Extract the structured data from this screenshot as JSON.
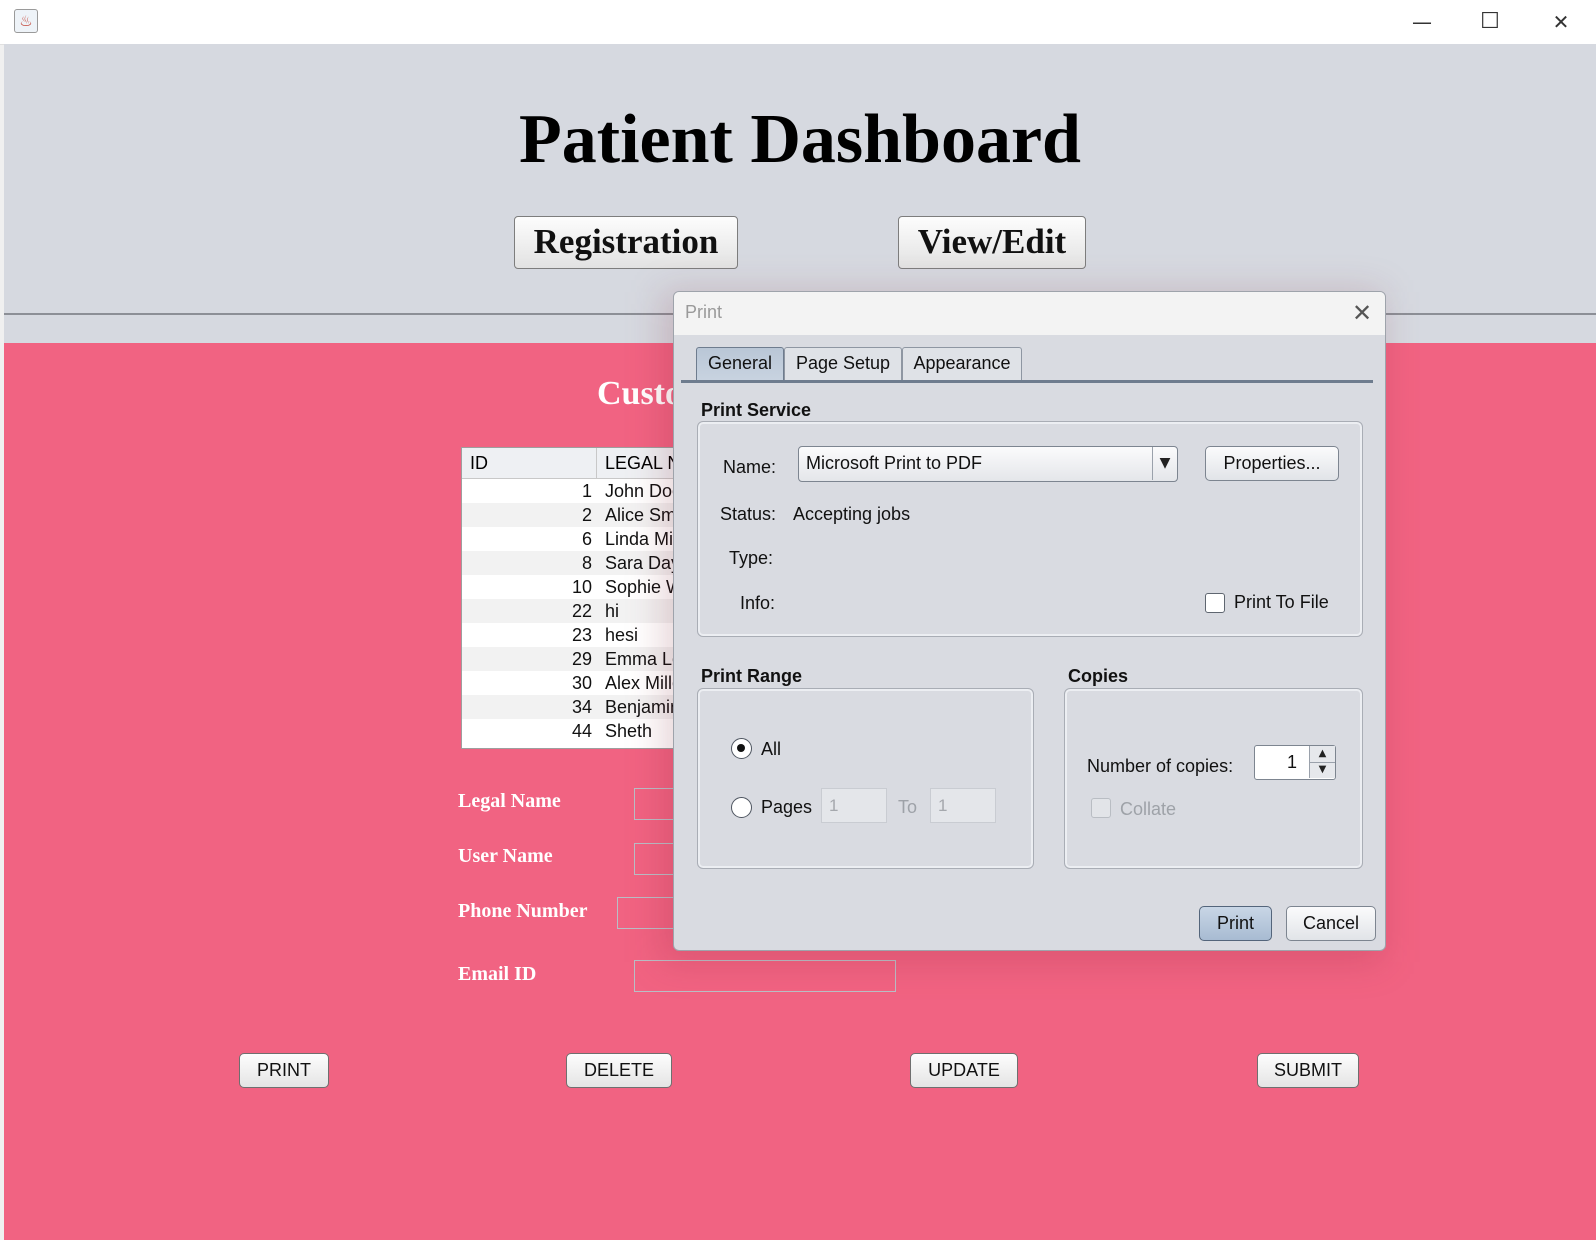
{
  "window": {
    "minimize_glyph": "—",
    "maximize_glyph": "☐",
    "close_glyph": "✕",
    "icon": "java-cup-icon"
  },
  "header": {
    "title": "Patient Dashboard",
    "buttons": {
      "registration": "Registration",
      "view_edit": "View/Edit"
    }
  },
  "main": {
    "section_title": "Custo",
    "table": {
      "columns": [
        "ID",
        "LEGAL N"
      ],
      "rows": [
        {
          "id": "1",
          "name": "John Doe"
        },
        {
          "id": "2",
          "name": "Alice Sm"
        },
        {
          "id": "6",
          "name": "Linda Mi"
        },
        {
          "id": "8",
          "name": "Sara Day"
        },
        {
          "id": "10",
          "name": "Sophie W"
        },
        {
          "id": "22",
          "name": "hi"
        },
        {
          "id": "23",
          "name": "hesi"
        },
        {
          "id": "29",
          "name": "Emma Le"
        },
        {
          "id": "30",
          "name": "Alex Mille"
        },
        {
          "id": "34",
          "name": "Benjamin"
        },
        {
          "id": "44",
          "name": "Sheth"
        }
      ]
    },
    "form": {
      "legal_name_label": "Legal Name",
      "user_name_label": "User Name",
      "phone_label": "Phone Number",
      "email_label": "Email ID"
    },
    "actions": {
      "print": "PRINT",
      "delete": "DELETE",
      "update": "UPDATE",
      "submit": "SUBMIT"
    }
  },
  "print_dialog": {
    "title": "Print",
    "tabs": [
      "General",
      "Page Setup",
      "Appearance"
    ],
    "print_service": {
      "heading": "Print Service",
      "name_label": "Name:",
      "printer": "Microsoft Print to PDF",
      "properties_button": "Properties...",
      "status_label": "Status:",
      "status_value": "Accepting jobs",
      "type_label": "Type:",
      "info_label": "Info:",
      "print_to_file": "Print To File"
    },
    "print_range": {
      "heading": "Print Range",
      "all": "All",
      "pages": "Pages",
      "from": "1",
      "to_label": "To",
      "to": "1"
    },
    "copies": {
      "heading": "Copies",
      "number_label": "Number of copies:",
      "value": "1",
      "collate": "Collate"
    },
    "print_button": "Print",
    "cancel_button": "Cancel"
  }
}
